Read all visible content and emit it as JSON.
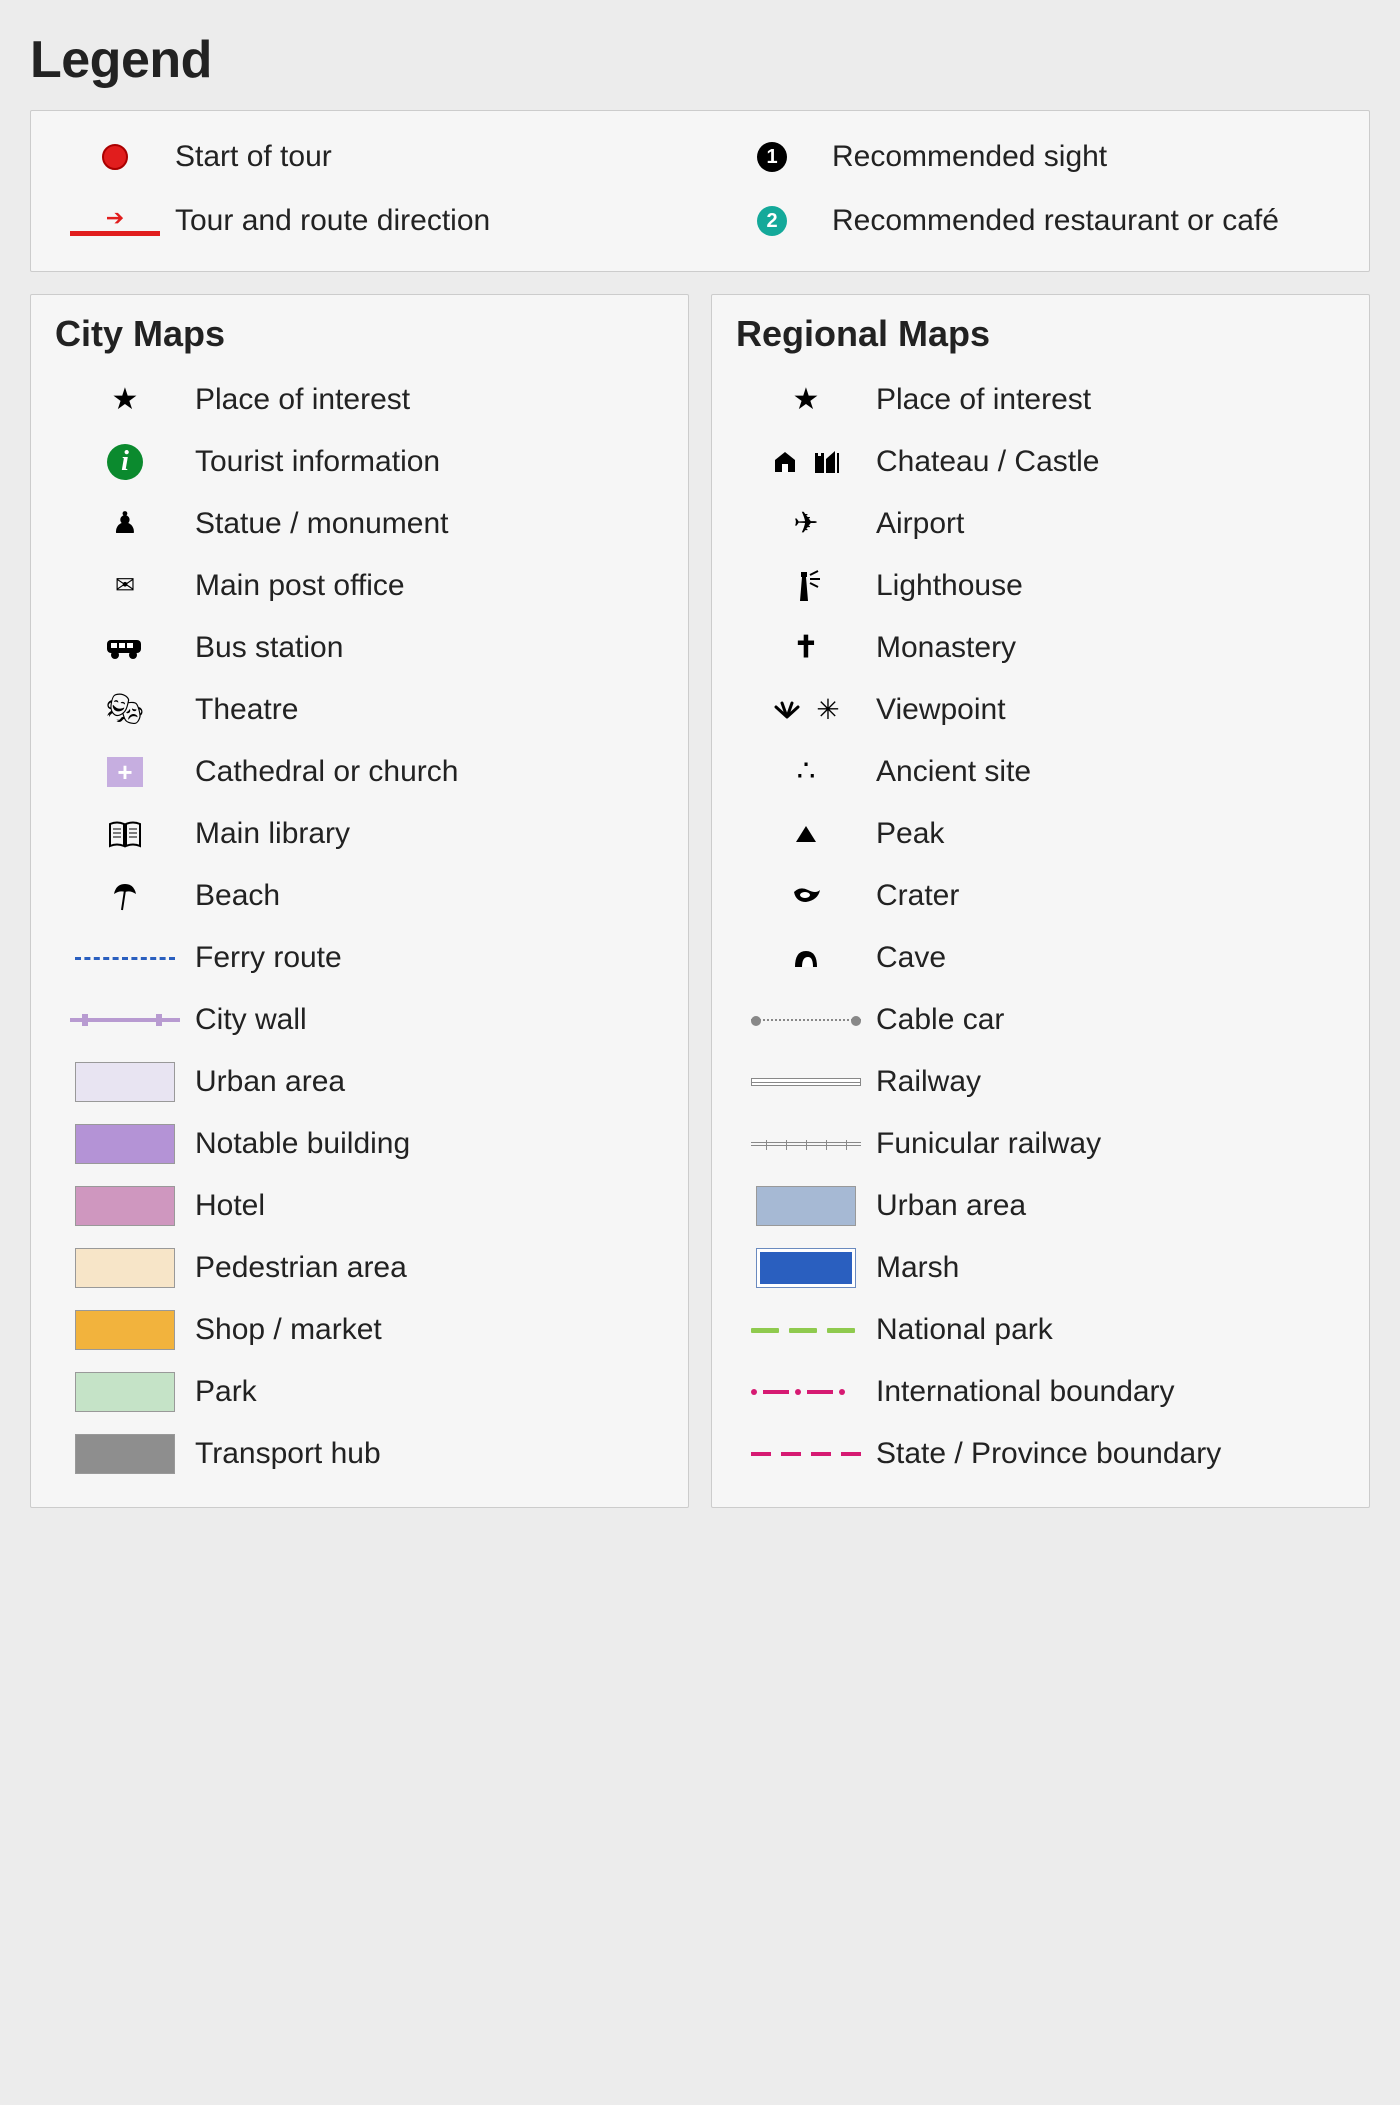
{
  "title": "Legend",
  "top": {
    "start": "Start of tour",
    "route": "Tour and route direction",
    "sight": "Recommended sight",
    "restaurant": "Recommended restaurant or café",
    "num1": "1",
    "num2": "2"
  },
  "city": {
    "heading": "City Maps",
    "items": [
      "Place of interest",
      "Tourist information",
      "Statue / monument",
      "Main post office",
      "Bus station",
      "Theatre",
      "Cathedral or church",
      "Main library",
      "Beach",
      "Ferry route",
      "City wall",
      "Urban area",
      "Notable building",
      "Hotel",
      "Pedestrian area",
      "Shop / market",
      "Park",
      "Transport hub"
    ]
  },
  "regional": {
    "heading": "Regional Maps",
    "items": [
      "Place of interest",
      "Chateau / Castle",
      "Airport",
      "Lighthouse",
      "Monastery",
      "Viewpoint",
      "Ancient site",
      "Peak",
      "Crater",
      "Cave",
      "Cable car",
      "Railway",
      "Funicular railway",
      "Urban area",
      "Marsh",
      "National park",
      "International boundary",
      "State / Province boundary"
    ]
  },
  "colors": {
    "urban_city": "#e8e4f2",
    "notable": "#b493d6",
    "hotel": "#cf97bf",
    "pedestrian": "#f7e5c8",
    "shop": "#f2b33d",
    "park": "#c5e3c7",
    "transport": "#8e8e8e",
    "urban_regional": "#a6b9d4"
  }
}
